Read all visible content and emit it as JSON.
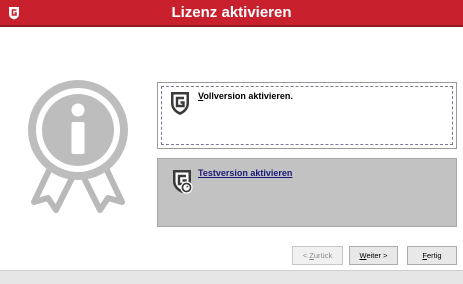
{
  "window": {
    "title": "Lizenz aktivieren",
    "brand_color": "#c8202d"
  },
  "options": {
    "full_version": {
      "label_prefix": "V",
      "label_rest": "ollversion aktivieren.",
      "icon": "gdata-shield-icon"
    },
    "trial_version": {
      "label": "Testversion aktivieren",
      "icon": "gdata-shield-clock-icon"
    }
  },
  "buttons": {
    "back": {
      "prefix": "< ",
      "accel": "Z",
      "rest": "urück",
      "enabled": false
    },
    "next": {
      "accel": "W",
      "rest": "eiter >"
    },
    "finish": {
      "accel": "F",
      "rest": "ertig"
    }
  },
  "decoration": {
    "badge_icon": "info-rosette-icon"
  }
}
